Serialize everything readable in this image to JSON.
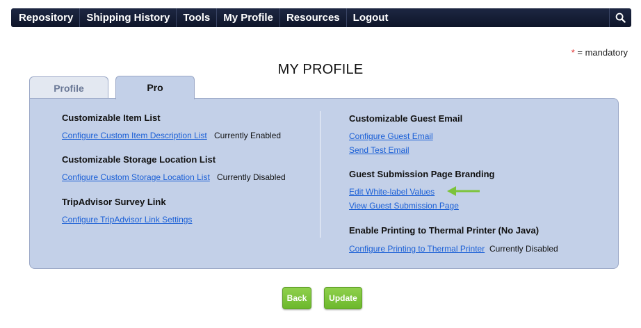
{
  "nav": {
    "items": [
      "Repository",
      "Shipping History",
      "Tools",
      "My Profile",
      "Resources",
      "Logout"
    ],
    "search_icon": "search-icon"
  },
  "mandatory": {
    "star": "*",
    "text": "= mandatory"
  },
  "page_title": "MY PROFILE",
  "tabs": [
    {
      "label": "Profile",
      "active": false
    },
    {
      "label": "Pro",
      "active": true
    }
  ],
  "left": {
    "item_list": {
      "heading": "Customizable Item List",
      "link": "Configure Custom Item Description List",
      "status": "Currently Enabled"
    },
    "storage_list": {
      "heading": "Customizable Storage Location List",
      "link": "Configure Custom Storage Location List",
      "status": "Currently Disabled"
    },
    "tripadvisor": {
      "heading": "TripAdvisor Survey Link",
      "link": "Configure TripAdvisor Link Settings"
    }
  },
  "right": {
    "guest_email": {
      "heading": "Customizable Guest Email",
      "link_configure": "Configure Guest Email",
      "link_test": "Send Test Email"
    },
    "branding": {
      "heading": "Guest Submission Page Branding",
      "link_edit": "Edit White-label Values",
      "link_view": "View Guest Submission Page"
    },
    "thermal": {
      "heading": "Enable Printing to Thermal Printer (No Java)",
      "link": "Configure Printing to Thermal Printer",
      "status": "Currently Disabled"
    }
  },
  "buttons": {
    "back": "Back",
    "update": "Update"
  },
  "colors": {
    "nav_bg": "#141c34",
    "panel_bg": "#c3d0e8",
    "link": "#1a5fd6",
    "button": "#7cc33a",
    "arrow": "#7cc33a",
    "mandatory_star": "#e03030"
  }
}
